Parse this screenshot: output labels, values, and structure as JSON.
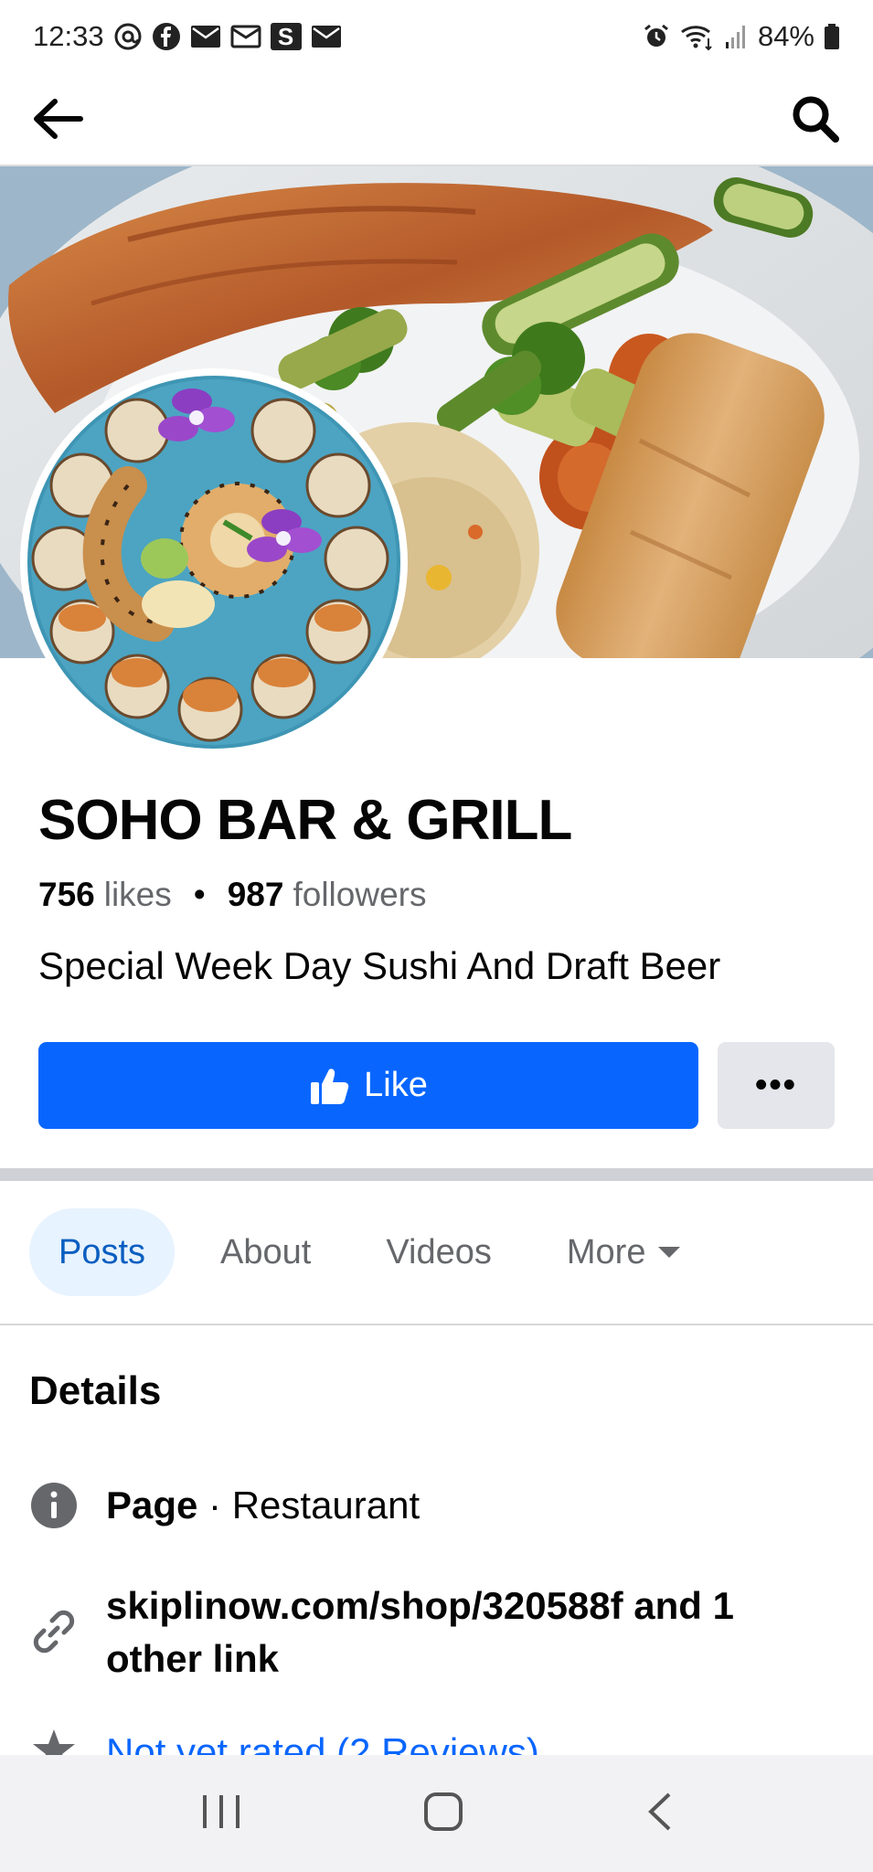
{
  "status_bar": {
    "time": "12:33",
    "battery": "84%",
    "icons": [
      "threads-icon",
      "facebook-icon",
      "mail-icon",
      "mail-outline-icon",
      "s-app-icon",
      "mail-icon-2",
      "alarm-icon",
      "wifi-icon",
      "signal-icon",
      "battery-icon"
    ],
    "s_app_label": "S"
  },
  "app_bar": {
    "back_icon": "arrow-left-icon",
    "search_icon": "search-icon"
  },
  "page": {
    "name": "SOHO BAR & GRILL",
    "likes_count": "756",
    "likes_label": "likes",
    "followers_count": "987",
    "followers_label": "followers",
    "separator": "•",
    "tagline": "Special Week Day Sushi And Draft Beer"
  },
  "actions": {
    "like_label": "Like",
    "more_label": "•••"
  },
  "tabs": [
    {
      "label": "Posts",
      "active": true
    },
    {
      "label": "About",
      "active": false
    },
    {
      "label": "Videos",
      "active": false
    },
    {
      "label": "More",
      "active": false
    }
  ],
  "details": {
    "title": "Details",
    "page_label": "Page",
    "page_separator": " · ",
    "category": "Restaurant",
    "website": "skiplinow.com/shop/320588f and 1 other link",
    "rating": "Not yet rated (2 Reviews)"
  },
  "colors": {
    "brand_blue": "#0866ff",
    "tab_active_bg": "#e7f3ff",
    "tab_active_text": "#0a5ec0",
    "muted_text": "#65676b"
  }
}
